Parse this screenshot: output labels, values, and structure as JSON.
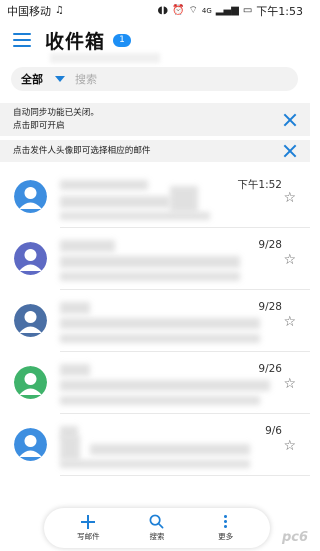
{
  "status_bar": {
    "carrier": "中国移动",
    "music_icon": "music-note-icon",
    "signal_badge": "4G",
    "time": "下午1:53"
  },
  "header": {
    "title": "收件箱",
    "unread_count": "1"
  },
  "search": {
    "filter_label": "全部",
    "placeholder": "搜索"
  },
  "notices": [
    {
      "text_line1": "自动同步功能已关闭。",
      "text_line2": "点击即可开启"
    },
    {
      "text_line1": "点击发件人头像即可选择相应的邮件"
    }
  ],
  "mails": [
    {
      "date": "下午1:52",
      "avatar_color": "#3d8ee0"
    },
    {
      "date": "9/28",
      "avatar_color": "#5e6ac4"
    },
    {
      "date": "9/28",
      "avatar_color": "#4a6fa5"
    },
    {
      "date": "9/26",
      "avatar_color": "#3fb36b"
    },
    {
      "date": "9/6",
      "avatar_color": "#3d8ee0"
    }
  ],
  "bottom_bar": {
    "compose_label": "写邮件",
    "search_label": "搜索",
    "more_label": "更多"
  },
  "watermark": "pc6"
}
